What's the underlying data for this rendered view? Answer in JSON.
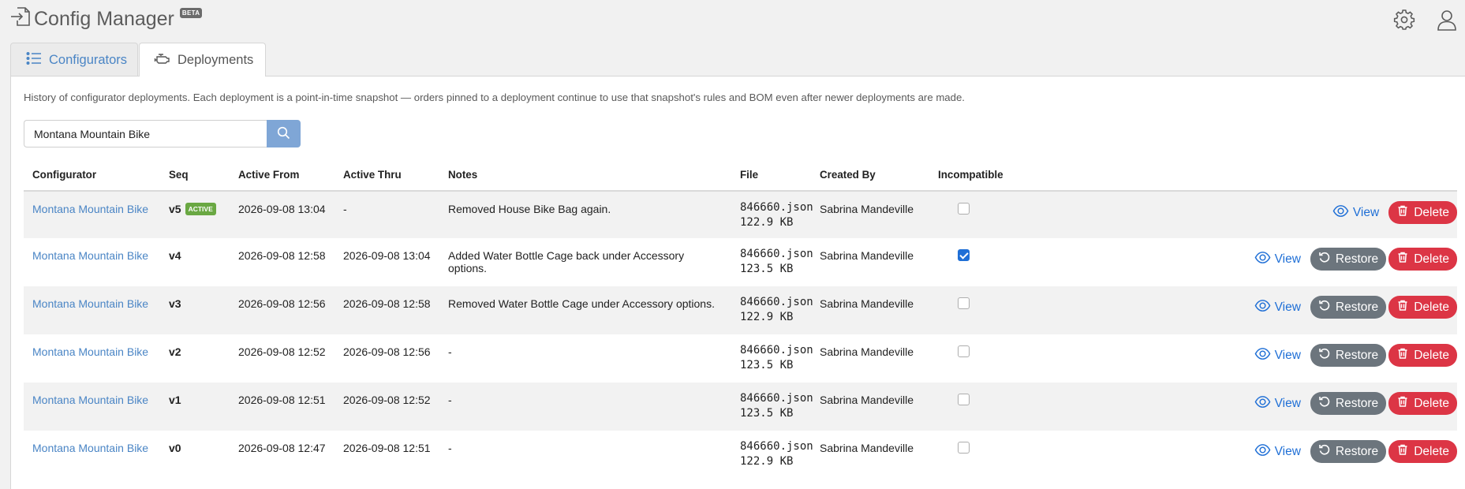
{
  "app": {
    "title": "Config Manager",
    "badge": "BETA"
  },
  "tabs": {
    "configurators": "Configurators",
    "deployments": "Deployments"
  },
  "description": "History of configurator deployments. Each deployment is a point-in-time snapshot — orders pinned to a deployment continue to use that snapshot's rules and BOM even after newer deployments are made.",
  "search": {
    "value": "Montana Mountain Bike"
  },
  "table": {
    "headers": {
      "configurator": "Configurator",
      "seq": "Seq",
      "active_from": "Active From",
      "active_thru": "Active Thru",
      "notes": "Notes",
      "file": "File",
      "created_by": "Created By",
      "incompatible": "Incompatible"
    },
    "active_label": "ACTIVE",
    "view_label": "View",
    "restore_label": "Restore",
    "delete_label": "Delete",
    "rows": [
      {
        "configurator": "Montana Mountain Bike",
        "seq": "v5",
        "active": true,
        "active_from": "2026-09-08 13:04",
        "active_thru": "-",
        "notes": "Removed House Bike Bag again.",
        "file_name": "846660.json",
        "file_size": "122.9 KB",
        "created_by": "Sabrina Mandeville",
        "incompatible": false
      },
      {
        "configurator": "Montana Mountain Bike",
        "seq": "v4",
        "active": false,
        "active_from": "2026-09-08 12:58",
        "active_thru": "2026-09-08 13:04",
        "notes": "Added Water Bottle Cage back under Accessory options.",
        "file_name": "846660.json",
        "file_size": "123.5 KB",
        "created_by": "Sabrina Mandeville",
        "incompatible": true
      },
      {
        "configurator": "Montana Mountain Bike",
        "seq": "v3",
        "active": false,
        "active_from": "2026-09-08 12:56",
        "active_thru": "2026-09-08 12:58",
        "notes": "Removed Water Bottle Cage under Accessory options.",
        "file_name": "846660.json",
        "file_size": "122.9 KB",
        "created_by": "Sabrina Mandeville",
        "incompatible": false
      },
      {
        "configurator": "Montana Mountain Bike",
        "seq": "v2",
        "active": false,
        "active_from": "2026-09-08 12:52",
        "active_thru": "2026-09-08 12:56",
        "notes": "-",
        "file_name": "846660.json",
        "file_size": "123.5 KB",
        "created_by": "Sabrina Mandeville",
        "incompatible": false
      },
      {
        "configurator": "Montana Mountain Bike",
        "seq": "v1",
        "active": false,
        "active_from": "2026-09-08 12:51",
        "active_thru": "2026-09-08 12:52",
        "notes": "-",
        "file_name": "846660.json",
        "file_size": "123.5 KB",
        "created_by": "Sabrina Mandeville",
        "incompatible": false
      },
      {
        "configurator": "Montana Mountain Bike",
        "seq": "v0",
        "active": false,
        "active_from": "2026-09-08 12:47",
        "active_thru": "2026-09-08 12:51",
        "notes": "-",
        "file_name": "846660.json",
        "file_size": "122.9 KB",
        "created_by": "Sabrina Mandeville",
        "incompatible": false
      }
    ]
  }
}
